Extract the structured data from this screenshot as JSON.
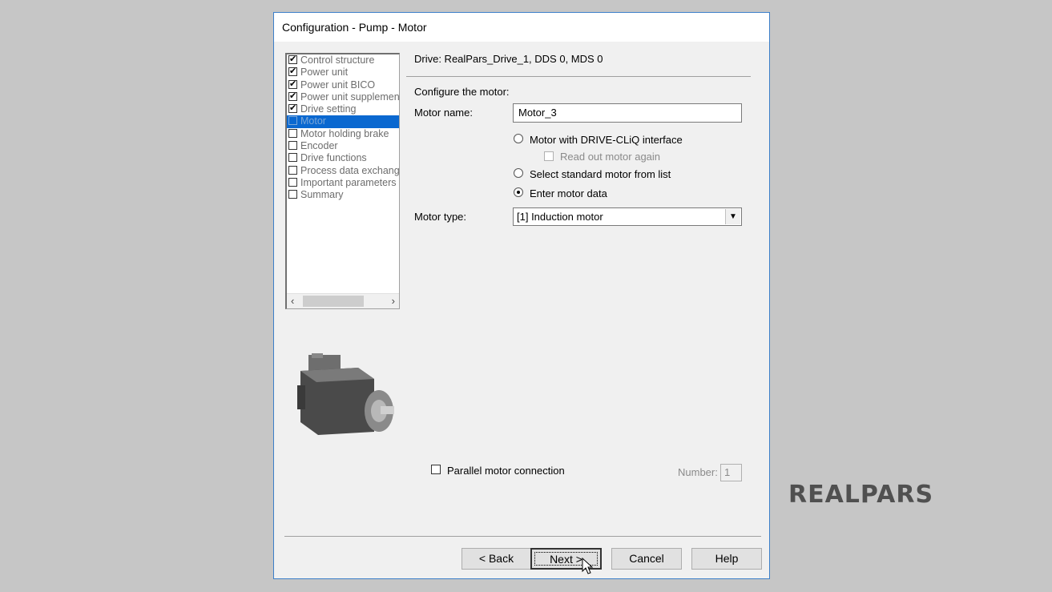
{
  "window": {
    "title": "Configuration - Pump - Motor"
  },
  "steps": [
    {
      "label": "Control structure",
      "checked": true
    },
    {
      "label": "Power unit",
      "checked": true
    },
    {
      "label": "Power unit BICO",
      "checked": true
    },
    {
      "label": "Power unit supplement",
      "checked": true
    },
    {
      "label": "Drive setting",
      "checked": true
    },
    {
      "label": "Motor",
      "checked": false,
      "selected": true
    },
    {
      "label": "Motor holding brake",
      "checked": false
    },
    {
      "label": "Encoder",
      "checked": false
    },
    {
      "label": "Drive functions",
      "checked": false
    },
    {
      "label": "Process data exchang",
      "checked": false
    },
    {
      "label": "Important parameters",
      "checked": false
    },
    {
      "label": "Summary",
      "checked": false
    }
  ],
  "main": {
    "drive_label": "Drive: RealPars_Drive_1, DDS 0, MDS 0",
    "configure_label": "Configure the motor:",
    "motor_name_label": "Motor name:",
    "motor_name_value": "Motor_3",
    "options": {
      "drive_cliq": "Motor with DRIVE-CLiQ interface",
      "read_out": "Read out motor again",
      "standard_list": "Select standard motor from list",
      "enter_data": "Enter motor data"
    },
    "motor_type_label": "Motor type:",
    "motor_type_value": "[1] Induction motor",
    "parallel_label": "Parallel motor connection",
    "number_label": "Number:",
    "number_value": "1"
  },
  "buttons": {
    "back": "< Back",
    "next": "Next >",
    "cancel": "Cancel",
    "help": "Help"
  },
  "logo_text": "REALPARS"
}
